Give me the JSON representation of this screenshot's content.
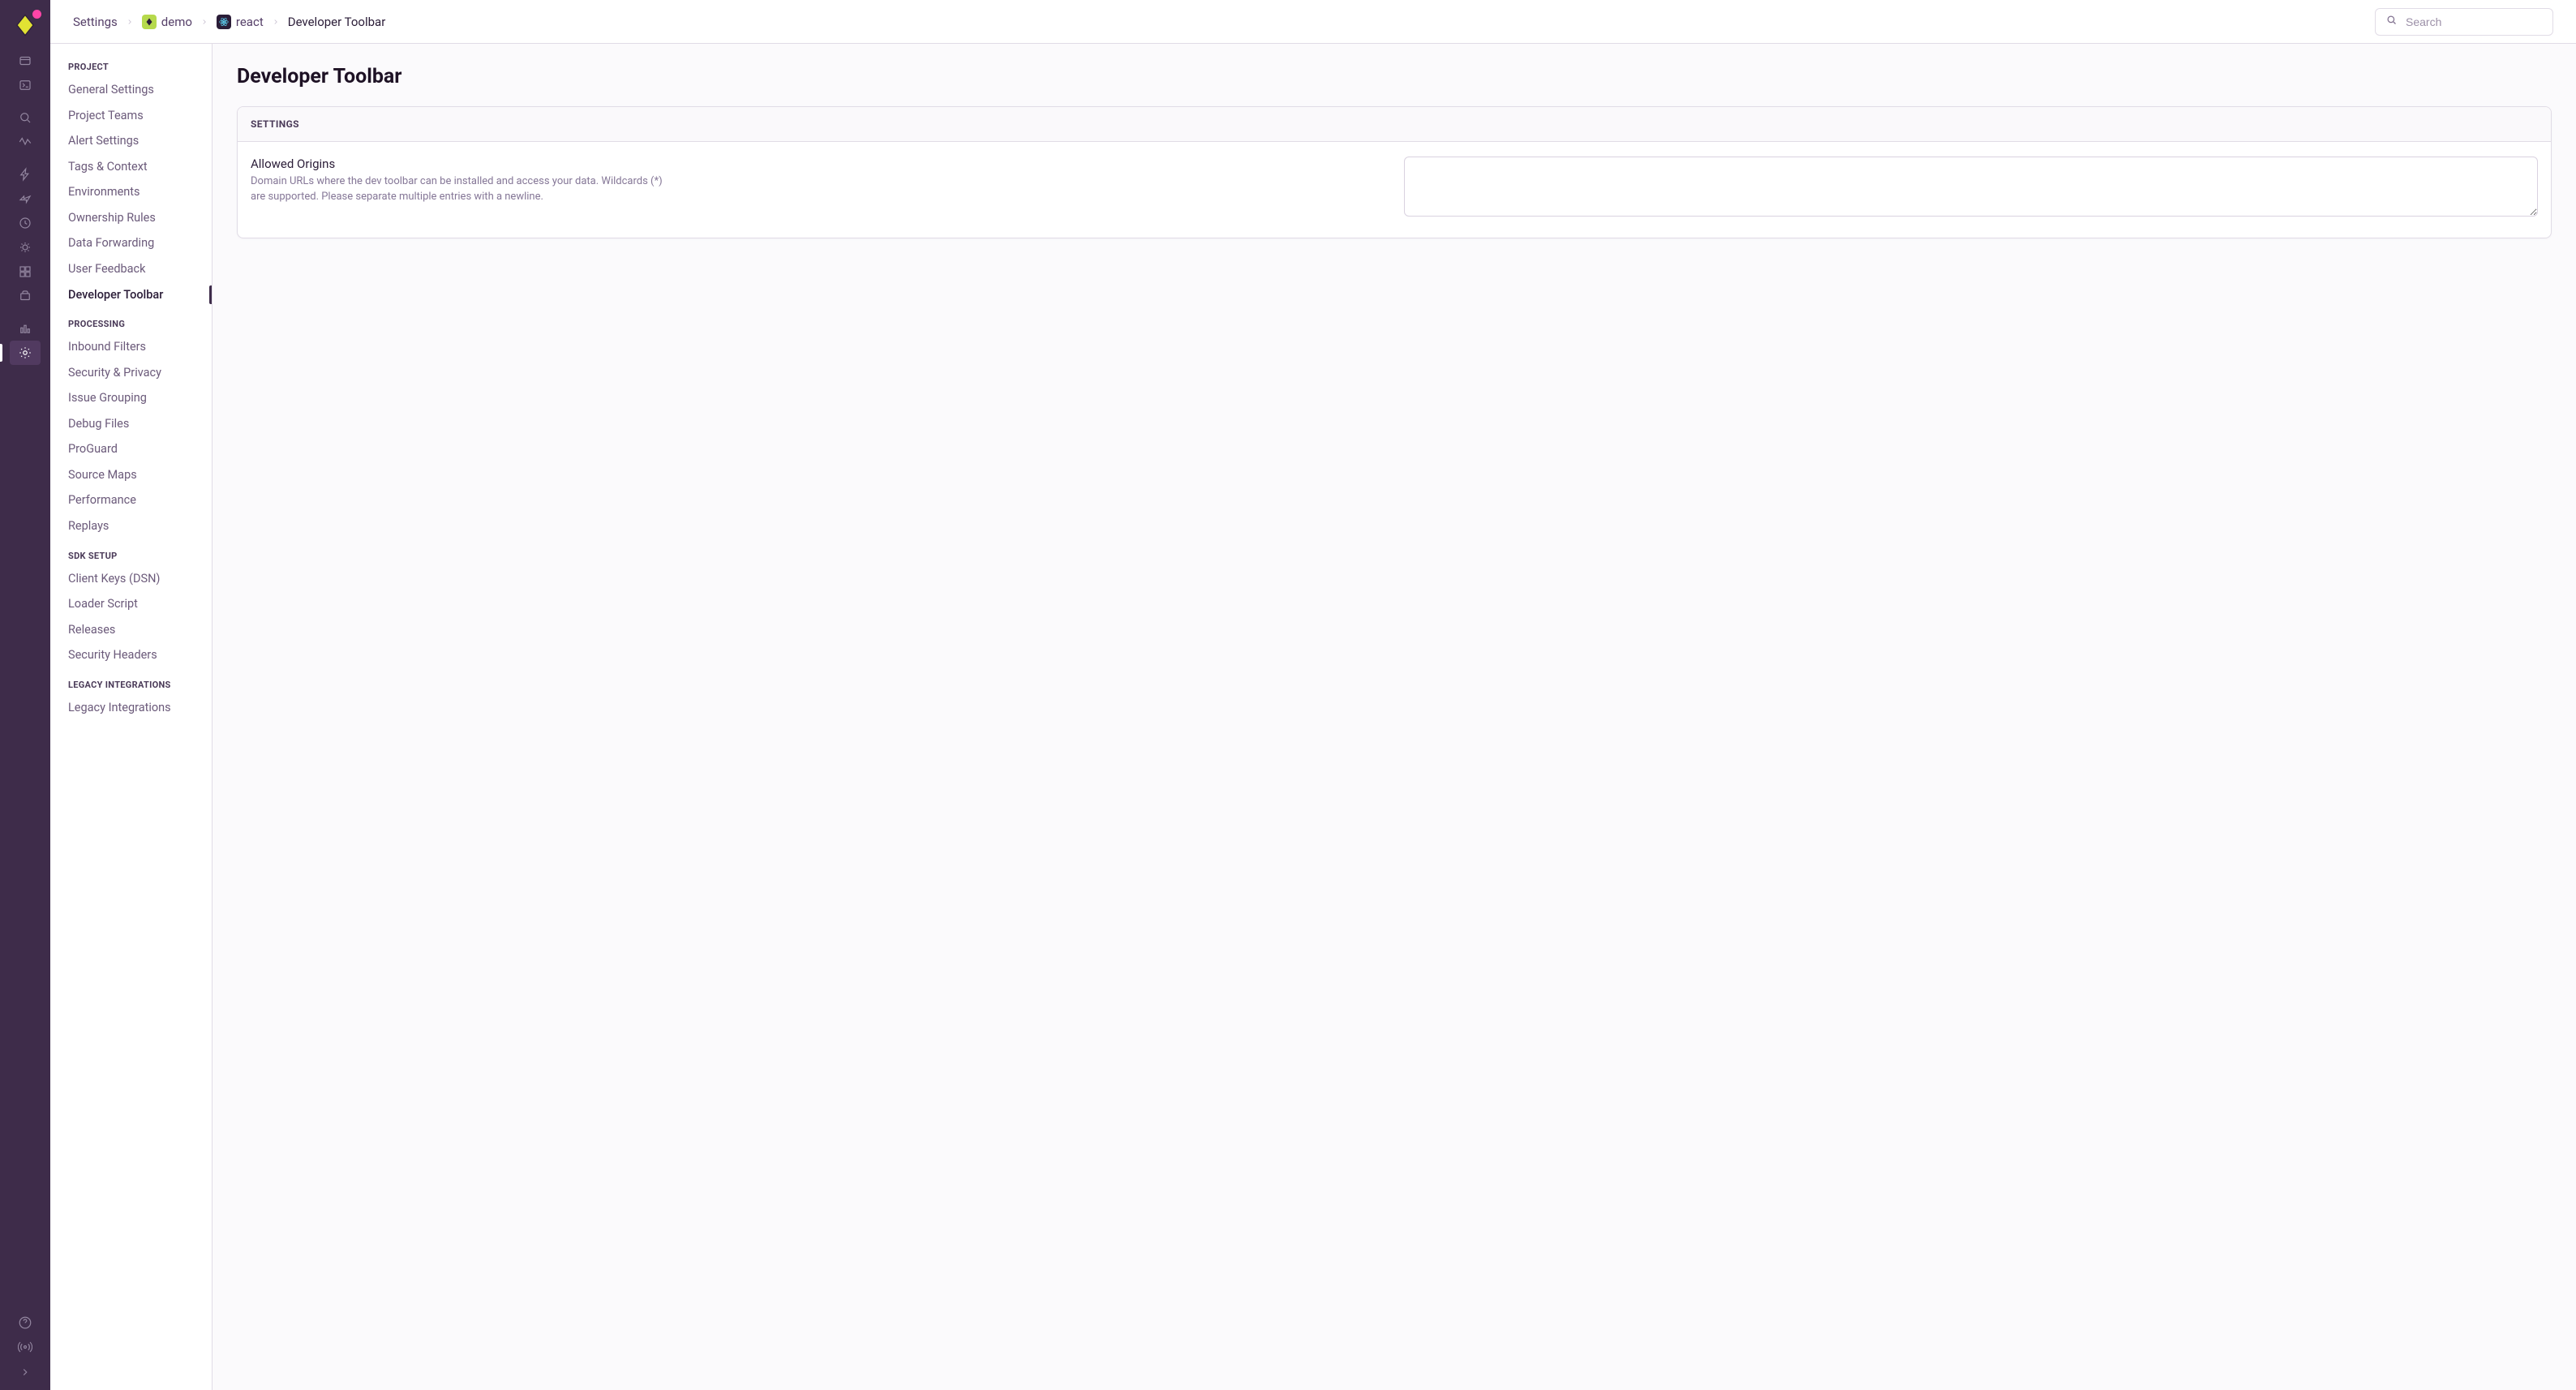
{
  "breadcrumbs": {
    "items": [
      {
        "label": "Settings"
      },
      {
        "label": "demo"
      },
      {
        "label": "react"
      },
      {
        "label": "Developer Toolbar"
      }
    ]
  },
  "search": {
    "placeholder": "Search"
  },
  "rail": {
    "items": [
      {
        "name": "projects-icon"
      },
      {
        "name": "issues-icon"
      },
      {
        "name": "search-icon"
      },
      {
        "name": "performance-icon"
      },
      {
        "name": "traces-icon"
      },
      {
        "name": "alerts-icon"
      },
      {
        "name": "crons-icon"
      },
      {
        "name": "profiling-icon"
      },
      {
        "name": "dashboards-icon"
      },
      {
        "name": "releases-icon"
      }
    ],
    "secondary": [
      {
        "name": "stats-icon"
      },
      {
        "name": "settings-icon",
        "active": true
      }
    ],
    "bottom": [
      {
        "name": "help-icon"
      },
      {
        "name": "broadcast-icon"
      }
    ]
  },
  "sidebar": {
    "groups": [
      {
        "heading": "PROJECT",
        "items": [
          {
            "label": "General Settings"
          },
          {
            "label": "Project Teams"
          },
          {
            "label": "Alert Settings"
          },
          {
            "label": "Tags & Context"
          },
          {
            "label": "Environments"
          },
          {
            "label": "Ownership Rules"
          },
          {
            "label": "Data Forwarding"
          },
          {
            "label": "User Feedback"
          },
          {
            "label": "Developer Toolbar",
            "active": true
          }
        ]
      },
      {
        "heading": "PROCESSING",
        "items": [
          {
            "label": "Inbound Filters"
          },
          {
            "label": "Security & Privacy"
          },
          {
            "label": "Issue Grouping"
          },
          {
            "label": "Debug Files"
          },
          {
            "label": "ProGuard"
          },
          {
            "label": "Source Maps"
          },
          {
            "label": "Performance"
          },
          {
            "label": "Replays"
          }
        ]
      },
      {
        "heading": "SDK SETUP",
        "items": [
          {
            "label": "Client Keys (DSN)"
          },
          {
            "label": "Loader Script"
          },
          {
            "label": "Releases"
          },
          {
            "label": "Security Headers"
          }
        ]
      },
      {
        "heading": "LEGACY INTEGRATIONS",
        "items": [
          {
            "label": "Legacy Integrations"
          }
        ]
      }
    ]
  },
  "page": {
    "title": "Developer Toolbar",
    "panel_heading": "SETTINGS",
    "field_label": "Allowed Origins",
    "field_help": "Domain URLs where the dev toolbar can be installed and access your data. Wildcards (*) are supported. Please separate multiple entries with a newline.",
    "field_value": ""
  }
}
